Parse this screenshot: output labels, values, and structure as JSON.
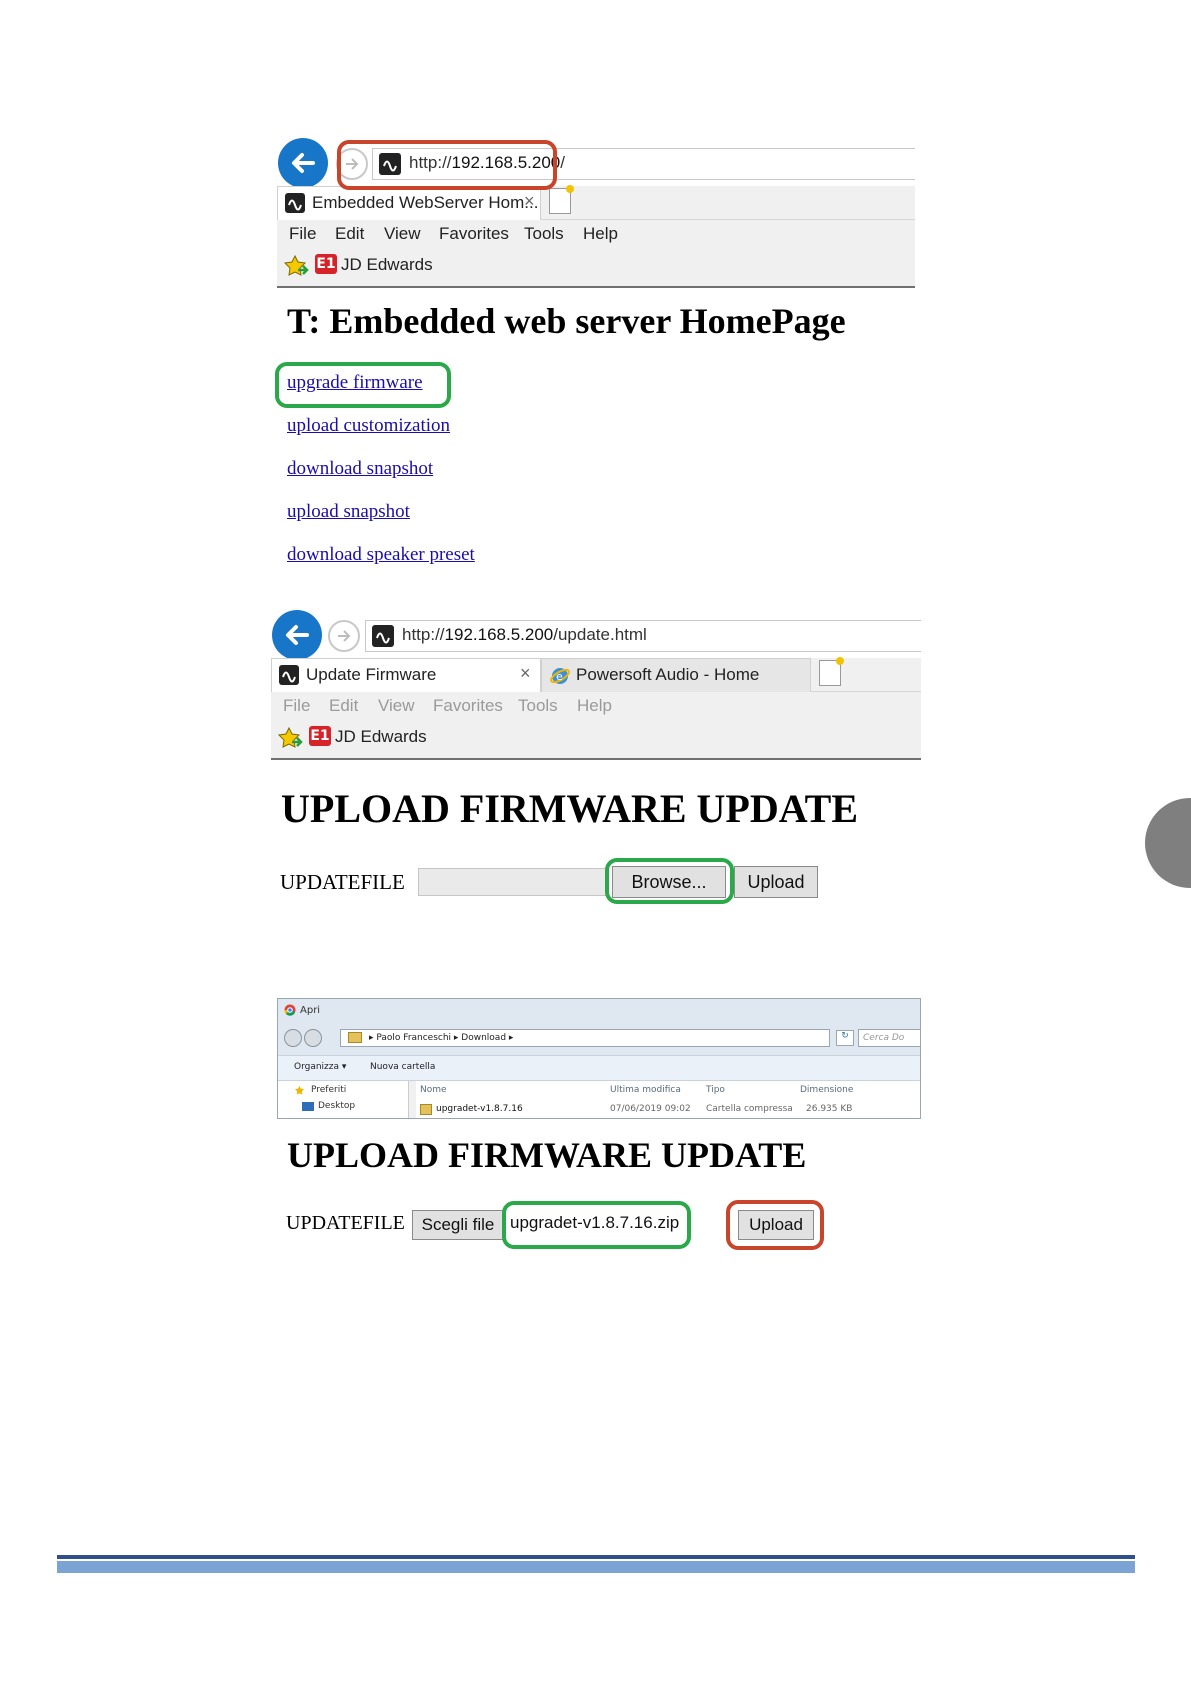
{
  "colors": {
    "accent_blue": "#1876c9",
    "highlight_red": "#c8442a",
    "highlight_green": "#2aa84a",
    "link": "#1a0dab",
    "footer_dark": "#2f4f8f",
    "footer_light": "#7ba3d4",
    "side_tab": "#7f7f7f"
  },
  "screen1": {
    "url": {
      "scheme": "http://",
      "host": "192.168.5.200",
      "tail": "/"
    },
    "tab_title": "Embedded WebServer Hom...",
    "close_glyph": "×",
    "menu": [
      "File",
      "Edit",
      "View",
      "Favorites",
      "Tools",
      "Help"
    ],
    "favorite": "JD Edwards",
    "page_title": "T: Embedded web server HomePage",
    "links": [
      "upgrade firmware",
      "upload customization",
      "download snapshot",
      "upload snapshot",
      "download speaker preset"
    ]
  },
  "screen2": {
    "url": {
      "scheme": "http://",
      "host": "192.168.5.200",
      "tail": "/update.html"
    },
    "tab_title": "Update Firmware",
    "tab2_title": "Powersoft Audio - Home",
    "close_glyph": "×",
    "menu": [
      "File",
      "Edit",
      "View",
      "Favorites",
      "Tools",
      "Help"
    ],
    "favorite": "JD Edwards",
    "page_title": "UPLOAD FIRMWARE UPDATE",
    "field_label": "UPDATEFILE",
    "browse_label": "Browse...",
    "upload_label": "Upload"
  },
  "dialog": {
    "title": "Apri",
    "path": "▸  Paolo Franceschi  ▸  Download  ▸",
    "search_placeholder": "Cerca Do",
    "toolbar": [
      "Organizza ▾",
      "Nuova cartella"
    ],
    "sidebar": [
      "Preferiti",
      "Desktop"
    ],
    "columns": [
      "Nome",
      "Ultima modifica",
      "Tipo",
      "Dimensione"
    ],
    "row": {
      "name": "upgradet-v1.8.7.16",
      "modified": "07/06/2019 09:02",
      "type": "Cartella compressa",
      "size": "26.935 KB"
    }
  },
  "screen3": {
    "page_title": "UPLOAD FIRMWARE UPDATE",
    "field_label": "UPDATEFILE",
    "choose_label": "Scegli file",
    "file_name": "upgradet-v1.8.7.16.zip",
    "upload_label": "Upload"
  }
}
